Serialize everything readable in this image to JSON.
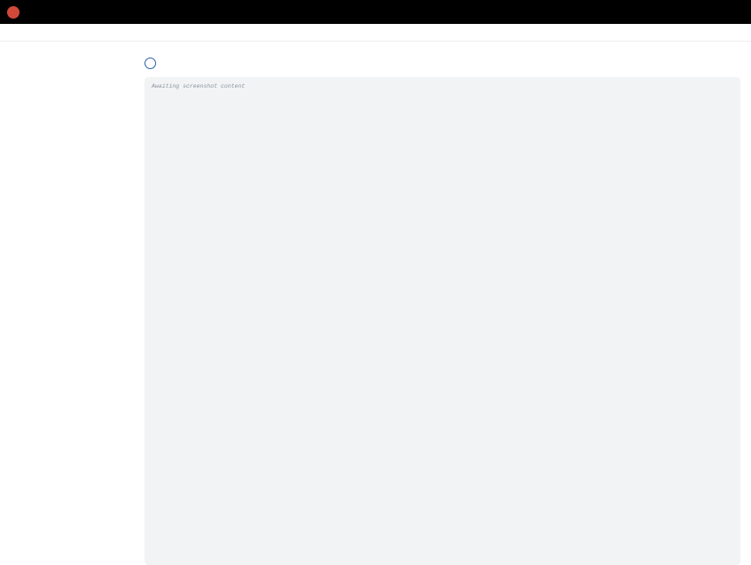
{
  "app": {
    "title": ""
  },
  "topbar": {
    "actions": []
  },
  "breadcrumbs": [],
  "sidebar": {
    "items": []
  },
  "main": {
    "title": "",
    "actions": []
  },
  "console": {
    "lines": []
  },
  "note": "Awaiting screenshot content"
}
